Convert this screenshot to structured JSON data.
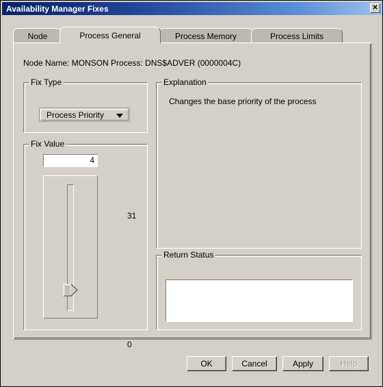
{
  "window": {
    "title": "Availability Manager Fixes",
    "close_label": "✕",
    "close_icon": "close-icon",
    "titlebar_gradient_start": "#0a246a",
    "titlebar_gradient_end": "#9ec3ec",
    "face_color": "#d4d0c8"
  },
  "tabs": [
    {
      "label": "Node",
      "selected": false
    },
    {
      "label": "Process General",
      "selected": true
    },
    {
      "label": "Process Memory",
      "selected": false
    },
    {
      "label": "Process Limits",
      "selected": false
    }
  ],
  "main": {
    "node_line": "Node Name:  MONSON  Process:  DNS$ADVER (0000004C)",
    "fix_type": {
      "title": "Fix Type",
      "selected": "Process Priority",
      "options": [
        "Process Priority"
      ],
      "arrow_icon": "chevron-down-icon"
    },
    "fix_value": {
      "title": "Fix Value",
      "value": "4",
      "slider": {
        "max_label": "31",
        "min_label": "0",
        "max": 31,
        "min": 0,
        "current": 4,
        "orientation": "vertical",
        "thumb_icon": "slider-thumb-icon"
      }
    },
    "explanation": {
      "title": "Explanation",
      "text": "Changes the base priority of the process"
    },
    "return_status": {
      "title": "Return Status",
      "text": ""
    }
  },
  "buttons": {
    "ok": "OK",
    "cancel": "Cancel",
    "apply": "Apply",
    "help": "Help"
  }
}
